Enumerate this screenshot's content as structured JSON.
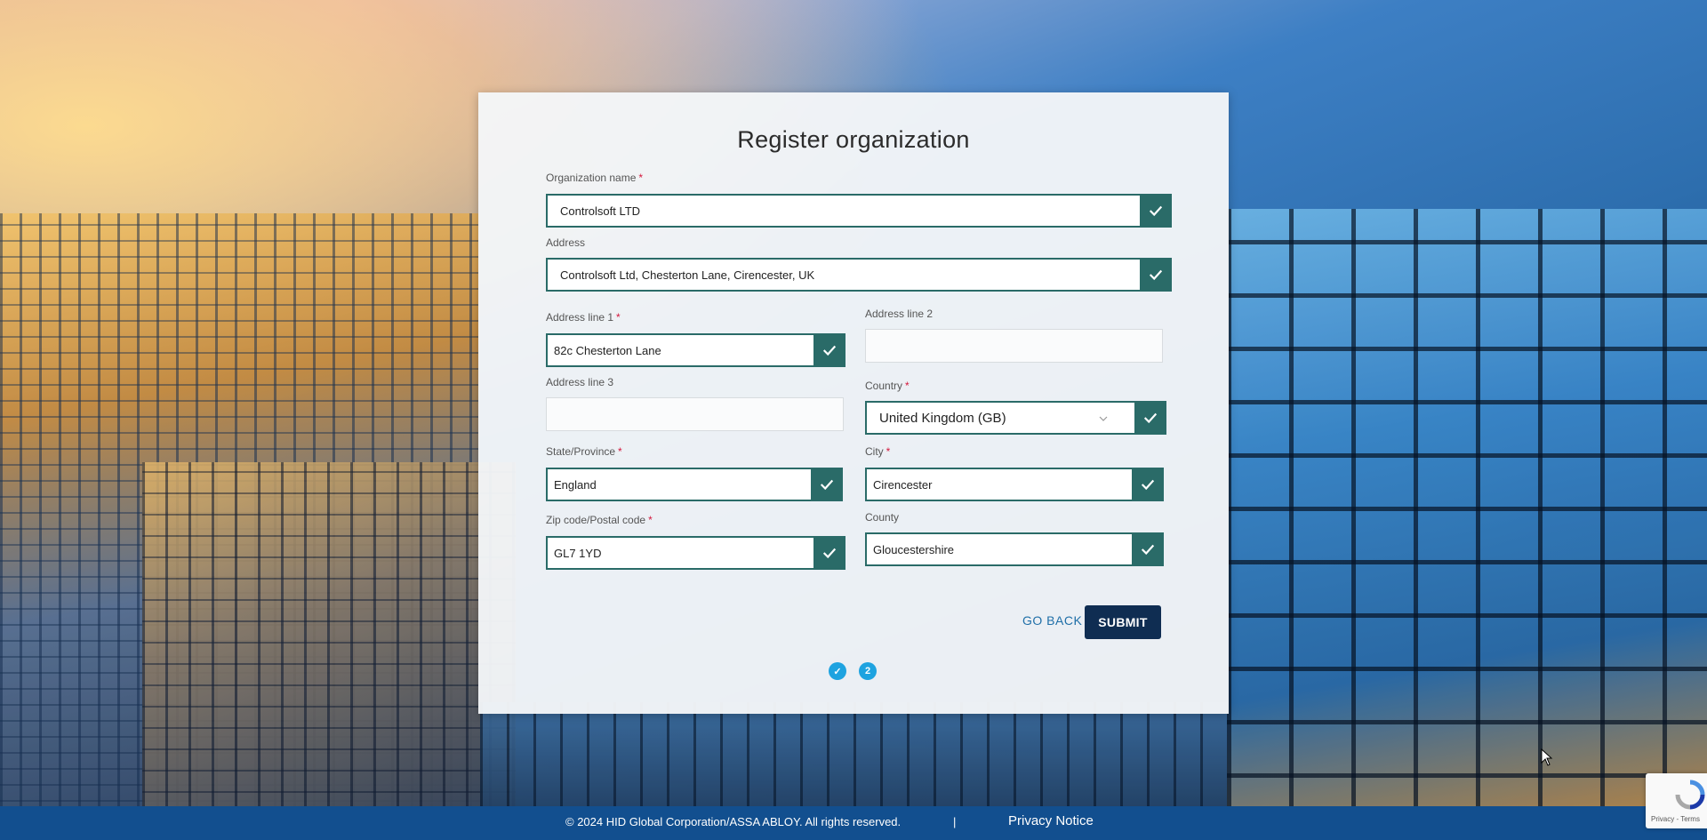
{
  "form": {
    "title": "Register organization",
    "fields": {
      "org_name": {
        "label": "Organization name",
        "required": "*",
        "value": "Controlsoft LTD"
      },
      "address": {
        "label": "Address",
        "value": "Controlsoft Ltd, Chesterton Lane, Cirencester, UK"
      },
      "address_line1": {
        "label": "Address line 1",
        "required": "*",
        "value": "82c Chesterton Lane"
      },
      "address_line2": {
        "label": "Address line 2",
        "value": ""
      },
      "address_line3": {
        "label": "Address line 3",
        "value": ""
      },
      "country": {
        "label": "Country",
        "required": "*",
        "value": "United Kingdom (GB)"
      },
      "state": {
        "label": "State/Province",
        "required": "*",
        "value": "England"
      },
      "city": {
        "label": "City",
        "required": "*",
        "value": "Cirencester"
      },
      "zip": {
        "label": "Zip code/Postal code",
        "required": "*",
        "value": "GL7 1YD"
      },
      "county": {
        "label": "County",
        "value": "Gloucestershire"
      }
    },
    "go_back_label": "GO BACK",
    "submit_label": "SUBMIT",
    "steps": [
      {
        "label": "✓",
        "state": "complete"
      },
      {
        "label": "2",
        "state": "current"
      }
    ]
  },
  "footer": {
    "copyright": "© 2024 HID Global Corporation/ASSA ABLOY. All rights reserved.",
    "separator": "|",
    "privacy": "Privacy Notice"
  },
  "recaptcha": {
    "terms": "Privacy - Terms"
  },
  "colors": {
    "valid_border": "#2a6b68",
    "submit_bg": "#0f2d52",
    "footer_bg": "#124f8f",
    "step_bg": "#1ea3e0",
    "required": "#d4183d"
  }
}
